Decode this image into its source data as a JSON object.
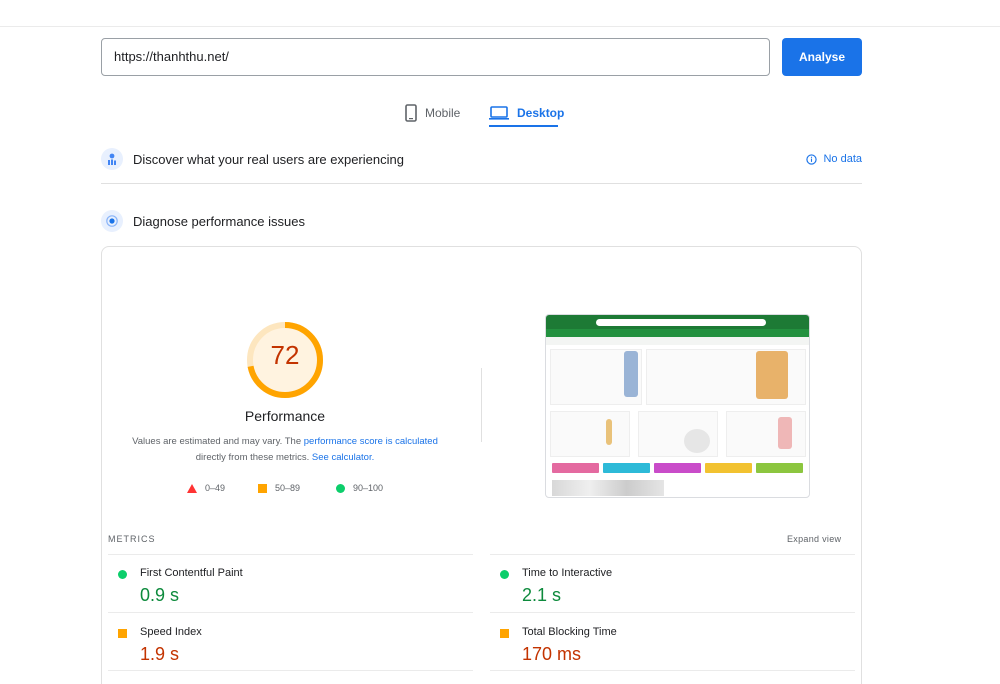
{
  "search": {
    "url_value": "https://thanhthu.net/",
    "analyse_label": "Analyse"
  },
  "tabs": [
    {
      "label": "Mobile",
      "active": false
    },
    {
      "label": "Desktop",
      "active": true
    }
  ],
  "field_data": {
    "title": "Discover what your real users are experiencing",
    "status_label": "No data"
  },
  "lab_data": {
    "title": "Diagnose performance issues",
    "score": "72",
    "score_color": "#ffa400",
    "score_fraction": 0.72,
    "category_label": "Performance",
    "note_prefix": "Values are estimated and may vary. The ",
    "note_link1": "performance score is calculated",
    "note_middle": " directly from these metrics. ",
    "note_link2": "See calculator.",
    "legend": [
      {
        "shape": "triangle",
        "color": "#ff3333",
        "range": "0–49"
      },
      {
        "shape": "square",
        "color": "#ffa400",
        "range": "50–89"
      },
      {
        "shape": "circle",
        "color": "#0cce6b",
        "range": "90–100"
      }
    ]
  },
  "metrics": {
    "section_title": "METRICS",
    "expand_label": "Expand view",
    "items": [
      {
        "name": "First Contentful Paint",
        "value": "0.9 s",
        "status": "good"
      },
      {
        "name": "Time to Interactive",
        "value": "2.1 s",
        "status": "good"
      },
      {
        "name": "Speed Index",
        "value": "1.9 s",
        "status": "average"
      },
      {
        "name": "Total Blocking Time",
        "value": "170 ms",
        "status": "average"
      }
    ]
  },
  "colors": {
    "accent": "#1a73e8",
    "good": "#0cce6b",
    "average": "#ffa400",
    "poor": "#ff3333"
  }
}
